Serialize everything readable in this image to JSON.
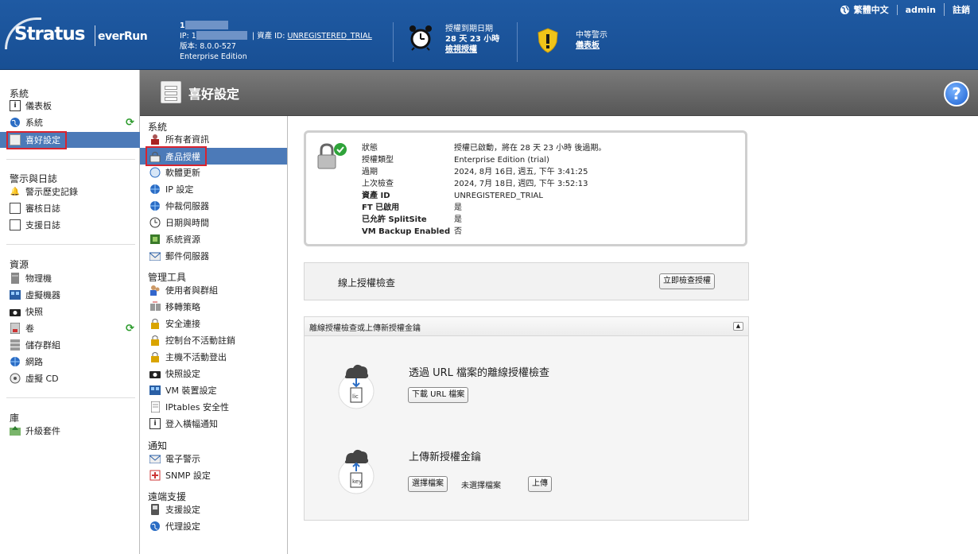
{
  "header": {
    "logo_main": "Stratus",
    "logo_sub": "everRun",
    "host_prefix": "1",
    "ip_prefix": "IP: 1",
    "asset_label": "資產 ID:",
    "asset_id": "UNREGISTERED_TRIAL",
    "version": "版本: 8.0.0-527",
    "edition": "Enterprise Edition",
    "license_title": "授權到期日期",
    "license_remaining": "28 天 23 小時",
    "license_link": "檢視授權",
    "alert_title": "中等警示",
    "alert_link": "儀表板",
    "language": "繁體中文",
    "user": "admin",
    "logout": "註銷"
  },
  "left_nav": {
    "system_header": "系統",
    "system_items": [
      {
        "label": "儀表板",
        "icon": "info-icon"
      },
      {
        "label": "系統",
        "icon": "globe-icon"
      },
      {
        "label": "喜好設定",
        "icon": "preferences-icon"
      }
    ],
    "alerts_header": "警示與日誌",
    "alerts_items": [
      {
        "label": "警示歷史記錄",
        "icon": "bell-icon"
      },
      {
        "label": "審核日誌",
        "icon": "calendar-icon"
      },
      {
        "label": "支援日誌",
        "icon": "log-icon"
      }
    ],
    "resources_header": "資源",
    "resources_items": [
      {
        "label": "物理機",
        "icon": "server-icon"
      },
      {
        "label": "虛擬機器",
        "icon": "vm-icon"
      },
      {
        "label": "快照",
        "icon": "camera-icon"
      },
      {
        "label": "卷",
        "icon": "volume-icon"
      },
      {
        "label": "儲存群組",
        "icon": "storage-icon"
      },
      {
        "label": "網路",
        "icon": "network-icon"
      },
      {
        "label": "虛擬 CD",
        "icon": "cd-icon"
      }
    ],
    "library_header": "庫",
    "library_items": [
      {
        "label": "升級套件",
        "icon": "upgrade-icon"
      }
    ]
  },
  "page_title": "喜好設定",
  "sub_nav": {
    "system_header": "系統",
    "system_items": [
      {
        "label": "所有者資訊",
        "icon": "owner-icon"
      },
      {
        "label": "產品授權",
        "icon": "license-icon"
      },
      {
        "label": "軟體更新",
        "icon": "update-icon"
      },
      {
        "label": "IP 設定",
        "icon": "ip-icon"
      },
      {
        "label": "仲裁伺服器",
        "icon": "quorum-icon"
      },
      {
        "label": "日期與時間",
        "icon": "clock-icon"
      },
      {
        "label": "系統資源",
        "icon": "chip-icon"
      },
      {
        "label": "郵件伺服器",
        "icon": "mail-icon"
      }
    ],
    "admin_header": "管理工具",
    "admin_items": [
      {
        "label": "使用者與群組",
        "icon": "users-icon"
      },
      {
        "label": "移轉策略",
        "icon": "migrate-icon"
      },
      {
        "label": "安全連接",
        "icon": "lock-icon"
      },
      {
        "label": "控制台不活動註銷",
        "icon": "lock-icon"
      },
      {
        "label": "主機不活動登出",
        "icon": "lock-icon"
      },
      {
        "label": "快照設定",
        "icon": "camera-icon"
      },
      {
        "label": "VM 裝置設定",
        "icon": "vm-device-icon"
      },
      {
        "label": "IPtables 安全性",
        "icon": "document-icon"
      },
      {
        "label": "登入橫幅通知",
        "icon": "info-icon"
      }
    ],
    "notify_header": "通知",
    "notify_items": [
      {
        "label": "電子警示",
        "icon": "mail-icon"
      },
      {
        "label": "SNMP 設定",
        "icon": "snmp-icon"
      }
    ],
    "remote_header": "遠端支援",
    "remote_items": [
      {
        "label": "支援設定",
        "icon": "phone-icon"
      },
      {
        "label": "代理設定",
        "icon": "proxy-icon"
      }
    ]
  },
  "license": {
    "rows": [
      {
        "key": "狀態",
        "value": "授權已啟動，將在 28 天 23 小時 後過期。"
      },
      {
        "key": "授權類型",
        "value": "Enterprise Edition (trial)"
      },
      {
        "key": "過期",
        "value": "2024, 8月 16日, 週五, 下午 3:41:25"
      },
      {
        "key": "上次檢查",
        "value": "2024, 7月 18日, 週四, 下午 3:52:13"
      },
      {
        "key": "資產 ID",
        "value": "UNREGISTERED_TRIAL"
      },
      {
        "key": "FT 已啟用",
        "value": "是"
      },
      {
        "key": "已允許 SplitSite",
        "value": "是"
      },
      {
        "key": "VM Backup Enabled",
        "value": "否"
      }
    ],
    "online_label": "線上授權檢查",
    "online_button": "立即檢查授權",
    "offline_header": "離線授權檢查或上傳新授權金鑰",
    "offline_title": "透過 URL 檔案的離線授權檢查",
    "download_button": "下載 URL 檔案",
    "upload_title": "上傳新授權金鑰",
    "choose_button": "選擇檔案",
    "no_file": "未選擇檔案",
    "upload_button": "上傳"
  }
}
